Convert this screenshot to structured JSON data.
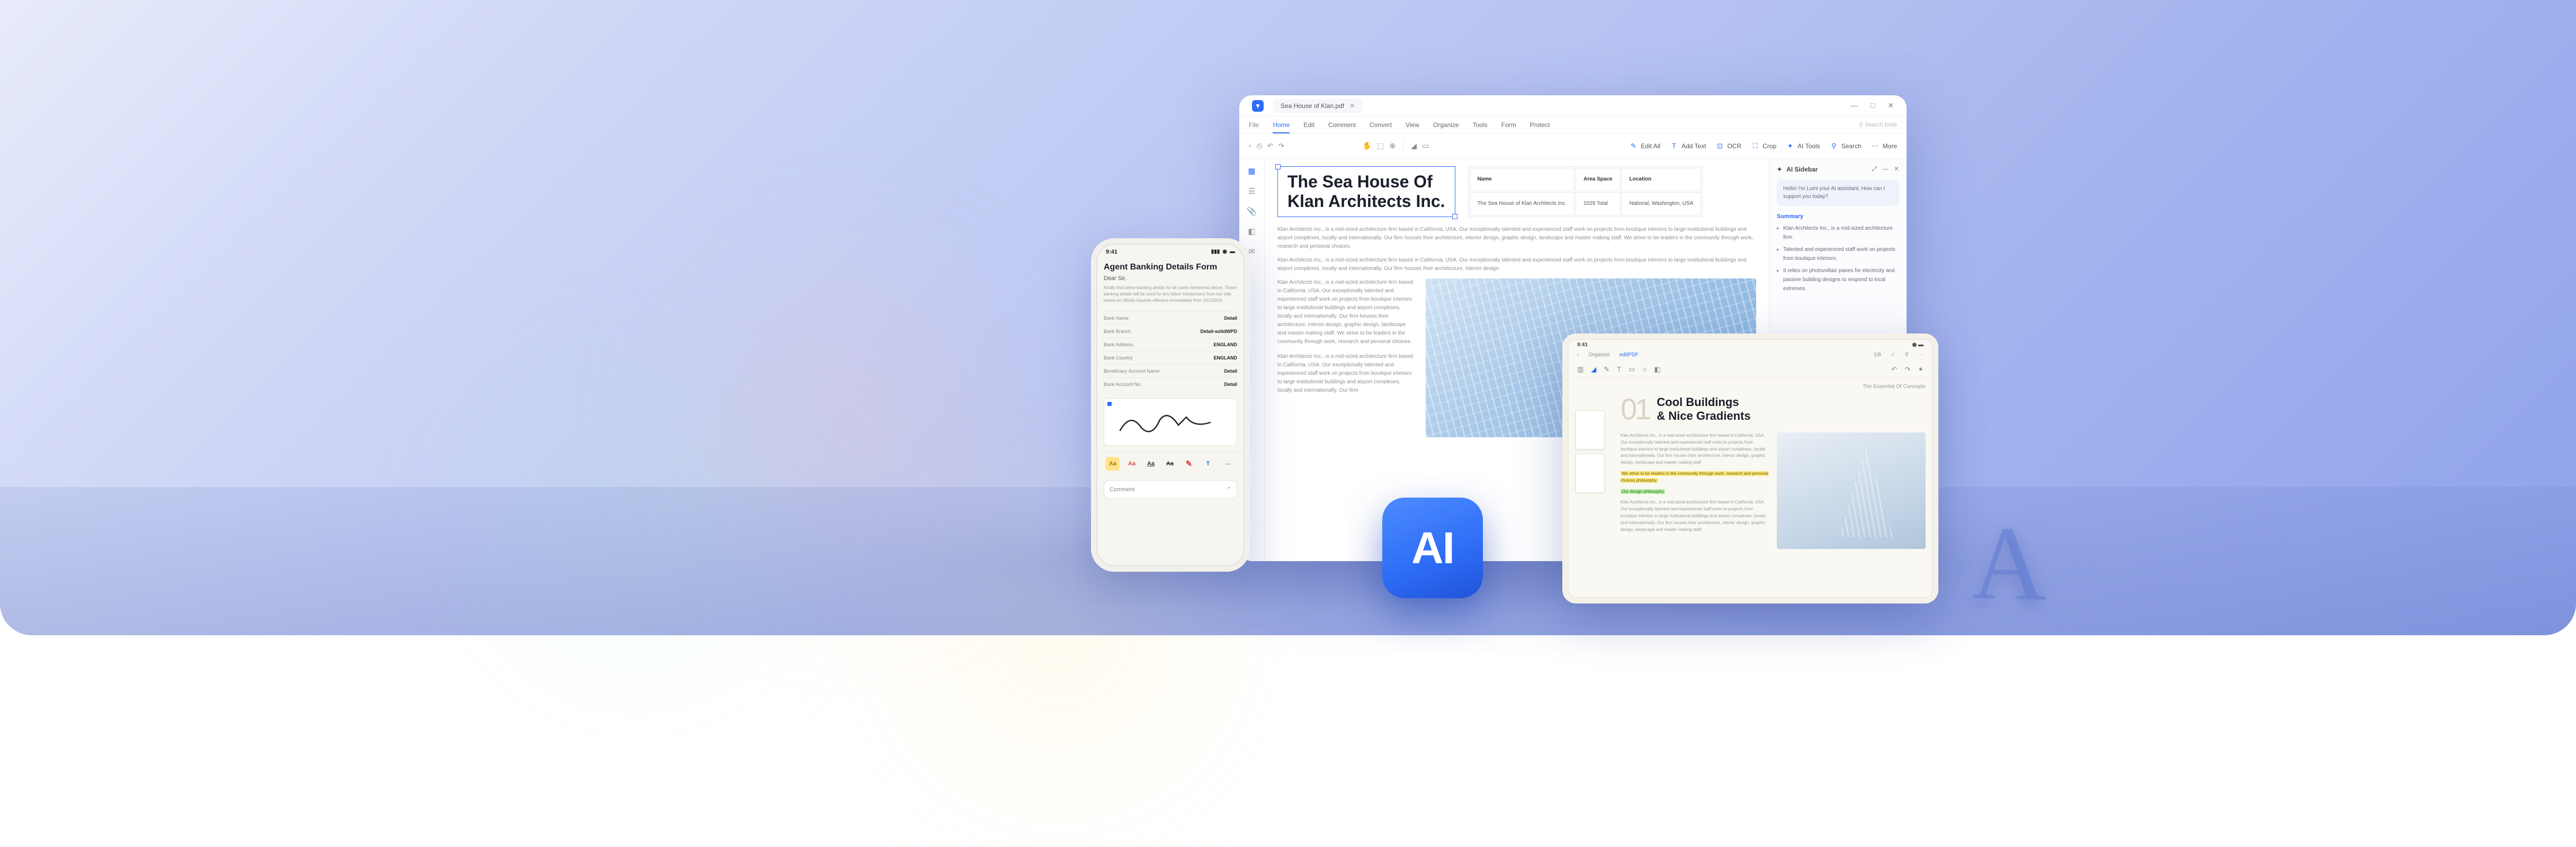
{
  "desktop": {
    "tab_title": "Sea House of Klan.pdf",
    "menus": {
      "file": "File",
      "home": "Home",
      "edit": "Edit",
      "comment": "Comment",
      "convert": "Convert",
      "view": "View",
      "organize": "Organize",
      "tools": "Tools",
      "form": "Form",
      "protect": "Protect"
    },
    "search_placeholder": "Search tools",
    "toolbar": {
      "edit_all": "Edit All",
      "add_text": "Add Text",
      "ocr": "OCR",
      "crop": "Crop",
      "ai_tools": "AI Tools",
      "search": "Search",
      "more": "More"
    },
    "page": {
      "title_line1": "The Sea House Of",
      "title_line2": "Klan Architects Inc.",
      "table": {
        "headers": [
          "Name",
          "Area Space",
          "Location"
        ],
        "row": [
          "The Sea House of Klan Architects Inc.",
          "1029 Total",
          "National, Washington, USA"
        ]
      },
      "para1": "Klan Architects Inc., is a mid-sized architecture firm based in California, USA. Our exceptionally talented and experienced staff work on projects from boutique interiors to large institutional buildings and airport complexes, locally and internationally. Our firm houses their architecture, interior design, graphic design, landscape and master making staff. We strive to be leaders in the community through work, research and personal choices.",
      "para2": "Klan Architects Inc., is a mid-sized architecture firm based in California, USA. Our exceptionally talented and experienced staff work on projects from boutique interiors to large institutional buildings and airport complexes, locally and internationally. Our firm houses their architecture, interior design.",
      "col1": "Klan Architects Inc., is a mid-sized architecture firm based in California, USA. Our exceptionally talented and experienced staff work on projects from boutique interiors to large institutional buildings and airport complexes, locally and internationally. Our firm houses their architecture, interior design, graphic design, landscape and master making staff. We strive to be leaders in the community through work, research and personal choices.",
      "col2": "Klan Architects Inc., is a mid-sized architecture firm based in California, USA. Our exceptionally talented and experienced staff work on projects from boutique interiors to large institutional buildings and airport complexes, locally and internationally. Our firm"
    },
    "ai_sidebar": {
      "title": "AI Sidebar",
      "bubble": "Hello! I'm Lumi your AI assistant. How can I support you today?",
      "summary_label": "Summary",
      "items": [
        "Klan Architects Inc., is a mid-sized architecture firm.",
        "Talented and experienced staff work on projects from boutique interiors.",
        "It relies on photovoltaic panes for electricity and passive building designs to respond to local extremes."
      ]
    }
  },
  "phone": {
    "time": "9:41",
    "title": "Agent Banking Details Form",
    "dear": "Dear Sir,",
    "body": "Kindly find below banking details for all cases mentioned above. These banking details will be used for any future transactions from our side based on official requisite effective immediately from 10/1/2024.",
    "rows": [
      {
        "k": "Bank Name",
        "v": "Detail"
      },
      {
        "k": "Bank Branch",
        "v": "Detail-solidWPD"
      },
      {
        "k": "Bank Address",
        "v": "ENGLAND"
      },
      {
        "k": "Bank Country",
        "v": "ENGLAND"
      },
      {
        "k": "Beneficiary Account Name",
        "v": "Detail"
      },
      {
        "k": "Bank Account No.",
        "v": "Detail"
      }
    ],
    "comment_placeholder": "Comment"
  },
  "tablet": {
    "time": "9:41",
    "top": {
      "edit": "Organize",
      "link": "editPDF",
      "num": "1/8"
    },
    "caption": "The Essential Of Concepts",
    "number": "01",
    "title_line1": "Cool Buildings",
    "title_line2": "& Nice Gradients",
    "col_text": "Klan Architects Inc., is a mid-sized architecture firm based in California, USA. Our exceptionally talented and experienced staff work on projects from boutique interiors to large institutional buildings and airport complexes, locally and internationally. Our firm houses their architecture, interior design, graphic design, landscape and master making staff.",
    "hl_text": "We strive to be leaders in the community through work, research and personal choices philosophy.",
    "hl_text2": "Our design philosophy"
  },
  "ai_badge": "AI"
}
